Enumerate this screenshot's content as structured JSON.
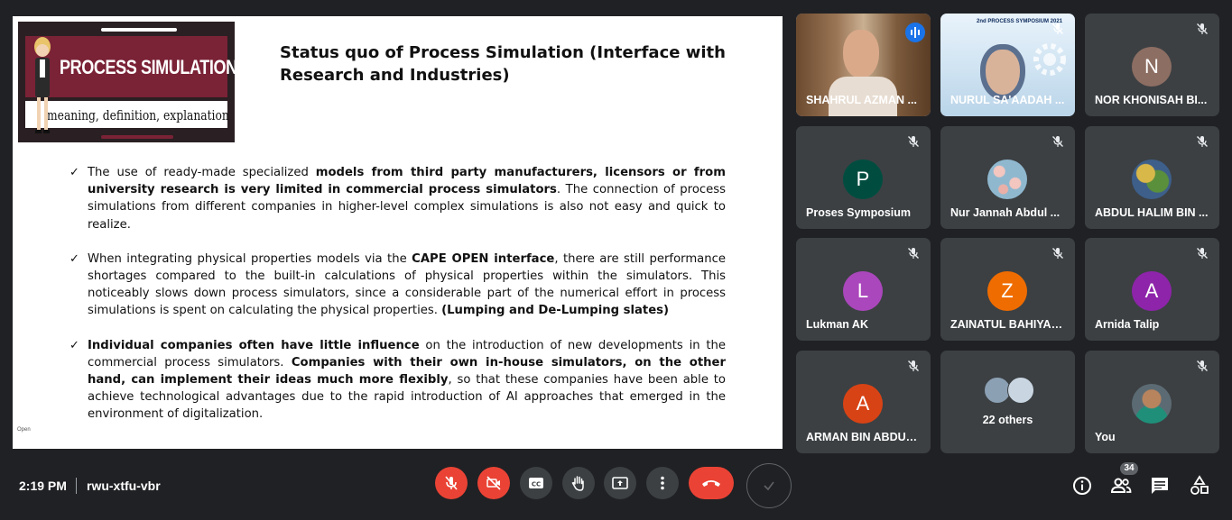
{
  "slide": {
    "thumb_title": "PROCESS SIMULATION",
    "thumb_subtitle": "meaning, definition, explanation",
    "title": "Status quo of Process Simulation (Interface with Research and Industries)",
    "footer": "Open",
    "bullets": [
      [
        {
          "t": "The use of ready-made specialized ",
          "b": false
        },
        {
          "t": "models from third party manufacturers, licensors or from university research is very limited in commercial process simulators",
          "b": true
        },
        {
          "t": ". The connection of process simulations from different companies in higher-level complex simulations is also not easy and quick to realize.",
          "b": false
        }
      ],
      [
        {
          "t": "When integrating physical properties models via the ",
          "b": false
        },
        {
          "t": "CAPE OPEN interface",
          "b": true
        },
        {
          "t": ", there are still performance shortages compared to the built-in calculations of physical properties within the simulators. This noticeably slows down process simulators, since a considerable part of the numerical effort in process simulations is spent on calculating the physical properties. ",
          "b": false
        },
        {
          "t": "(Lumping and De-Lumping slates)",
          "b": true
        }
      ],
      [
        {
          "t": "Individual companies often have little influence",
          "b": true
        },
        {
          "t": " on the introduction of new developments in the commercial process simulators. ",
          "b": false
        },
        {
          "t": "Companies with their own in-house simulators, on the other hand, can implement their ideas much more flexibly",
          "b": true
        },
        {
          "t": ", so that these companies have been able to achieve technological advantages due to the rapid introduction of AI approaches that emerged in the environment of digitalization.",
          "b": false
        }
      ]
    ]
  },
  "participants": {
    "p1": {
      "name": "SHAHRUL AZMAN ...",
      "icon": "speaking-icon"
    },
    "p2": {
      "name": "NURUL SA'AADAH ...",
      "banner": "2nd PROCESS SYMPOSIUM 2021"
    },
    "p3": {
      "name": "NOR KHONISAH BI...",
      "initial": "N",
      "color": "#8d6e63"
    },
    "p4": {
      "name": "Proses Symposium",
      "initial": "P",
      "color": "#00695c"
    },
    "p5": {
      "name": "Nur Jannah Abdul ..."
    },
    "p6": {
      "name": "ABDUL HALIM BIN ..."
    },
    "p7": {
      "name": "Lukman AK",
      "initial": "L",
      "color": "#ab47bc"
    },
    "p8": {
      "name": "ZAINATUL BAHIYAH...",
      "initial": "Z",
      "color": "#ef6c00"
    },
    "p9": {
      "name": "Arnida Talip",
      "initial": "A",
      "color": "#8e24aa"
    },
    "p10": {
      "name": "ARMAN BIN ABDUL...",
      "initial": "A",
      "color": "#d84315"
    },
    "p11": {
      "name": "22 others"
    },
    "p12": {
      "name": "You"
    }
  },
  "bar": {
    "time": "2:19 PM",
    "code": "rwu-xtfu-vbr",
    "people_count": "34"
  },
  "colors": {
    "bg": "#202124",
    "tile": "#3c4043",
    "danger": "#ea4335",
    "accent": "#1a73e8"
  }
}
